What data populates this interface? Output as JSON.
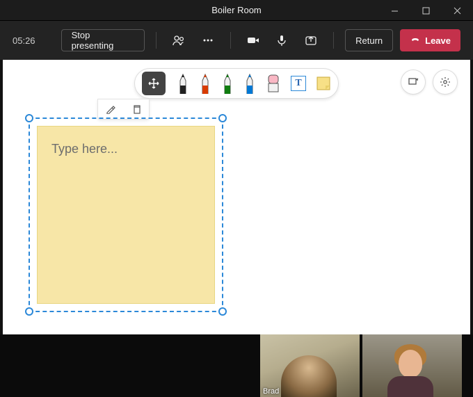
{
  "titlebar": {
    "title": "Boiler Room"
  },
  "toolbar": {
    "timer": "05:26",
    "stop_presenting": "Stop presenting",
    "return": "Return",
    "leave": "Leave"
  },
  "whiteboard": {
    "pens": [
      {
        "color": "#222222"
      },
      {
        "color": "#d83b01"
      },
      {
        "color": "#107c10"
      },
      {
        "color": "#0078d4"
      }
    ],
    "note_icon_color": "#f7e087",
    "sticky": {
      "placeholder": "Type here..."
    }
  },
  "participants": [
    {
      "name": "Brad"
    },
    {
      "name": ""
    }
  ]
}
